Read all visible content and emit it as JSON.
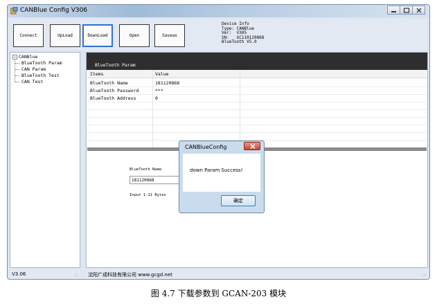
{
  "window": {
    "title": "CANBlue Config V306"
  },
  "toolbar": {
    "connect_label": "Connect",
    "upload_label": "UpLoad",
    "download_label": "DownLoad",
    "open_label": "Open",
    "saveas_label": "Saveas"
  },
  "device_info": {
    "heading": "Device Info",
    "type": "Type: CANBlue",
    "ver": "Ver:  V305",
    "sn": "SN:   GC110120868",
    "bluetooth": "BlueTooth V5.0"
  },
  "tree": {
    "root": "CANBlue",
    "items": [
      "BlueTooth Param",
      "CAN Param",
      "BlueTooth Test",
      "CAN Test"
    ]
  },
  "param_panel": {
    "title": "BlueTooth Param",
    "columns": [
      "Items",
      "Value"
    ],
    "rows": [
      {
        "item": "BlueTooth Name",
        "value": "181120868"
      },
      {
        "item": "BlueTooth Password",
        "value": "***"
      },
      {
        "item": "BlueTooth Address",
        "value": "0"
      }
    ]
  },
  "form": {
    "name_label": "BlueTooth Name",
    "name_value": "181120868",
    "hint": "Input 1-11 Bytes"
  },
  "dialog": {
    "title": "CANBlueConfig",
    "message": "down Param Success!",
    "ok_label": "确定"
  },
  "status": {
    "version": "V3.06",
    "company": "沈阳广成科技有限公司   www.gcgd.net"
  },
  "caption": "图 4.7  下载参数到 GCAN-203 模块",
  "colors": {
    "accent": "#2f6fd6",
    "header_dark": "#2e2e2e",
    "window_bg": "#dde6f1"
  }
}
